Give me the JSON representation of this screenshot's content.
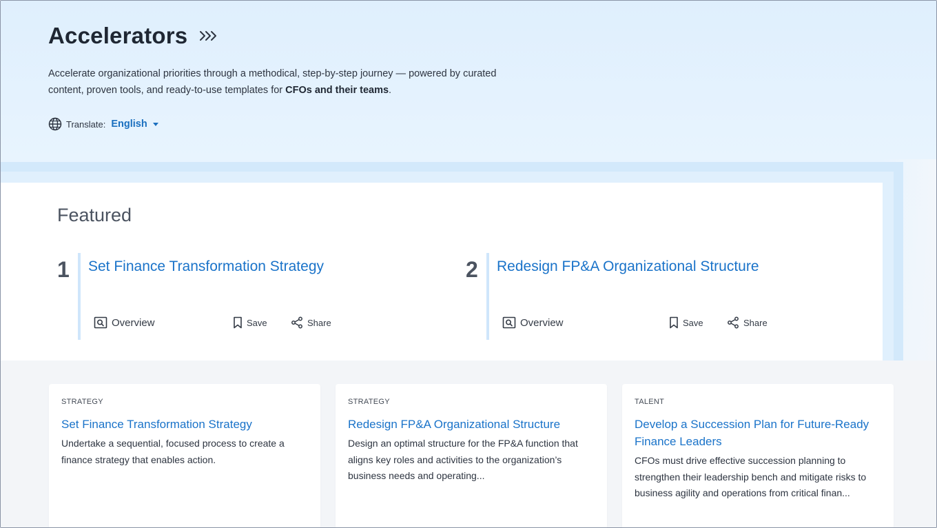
{
  "header": {
    "title": "Accelerators",
    "description_part1": "Accelerate organizational priorities through a methodical, step-by-step journey — powered by curated content, proven tools, and ready-to-use templates for ",
    "description_bold": "CFOs and their teams",
    "description_end": ".",
    "translate_label": "Translate:",
    "language": "English"
  },
  "featured": {
    "heading": "Featured",
    "items": [
      {
        "number": "1",
        "title": "Set Finance Transformation Strategy",
        "overview": "Overview",
        "save": "Save",
        "share": "Share"
      },
      {
        "number": "2",
        "title": "Redesign FP&A Organizational Structure",
        "overview": "Overview",
        "save": "Save",
        "share": "Share"
      }
    ]
  },
  "cards": [
    {
      "category": "STRATEGY",
      "title": "Set Finance Transformation Strategy",
      "description": "Undertake a sequential, focused process to create a finance strategy that enables action."
    },
    {
      "category": "STRATEGY",
      "title": "Redesign FP&A Organizational Structure",
      "description": "Design an optimal structure for the FP&A function that aligns key roles and activities to the organization’s business needs and operating..."
    },
    {
      "category": "TALENT",
      "title": "Develop a Succession Plan for Future-Ready Finance Leaders",
      "description": "CFOs must drive effective succession planning to strengthen their leadership bench and mitigate risks to business agility and operations from critical finan..."
    }
  ],
  "colors": {
    "accent": "#1a73c9",
    "hero_bg": "#e2f1fd",
    "band": "#d3e9fb"
  }
}
